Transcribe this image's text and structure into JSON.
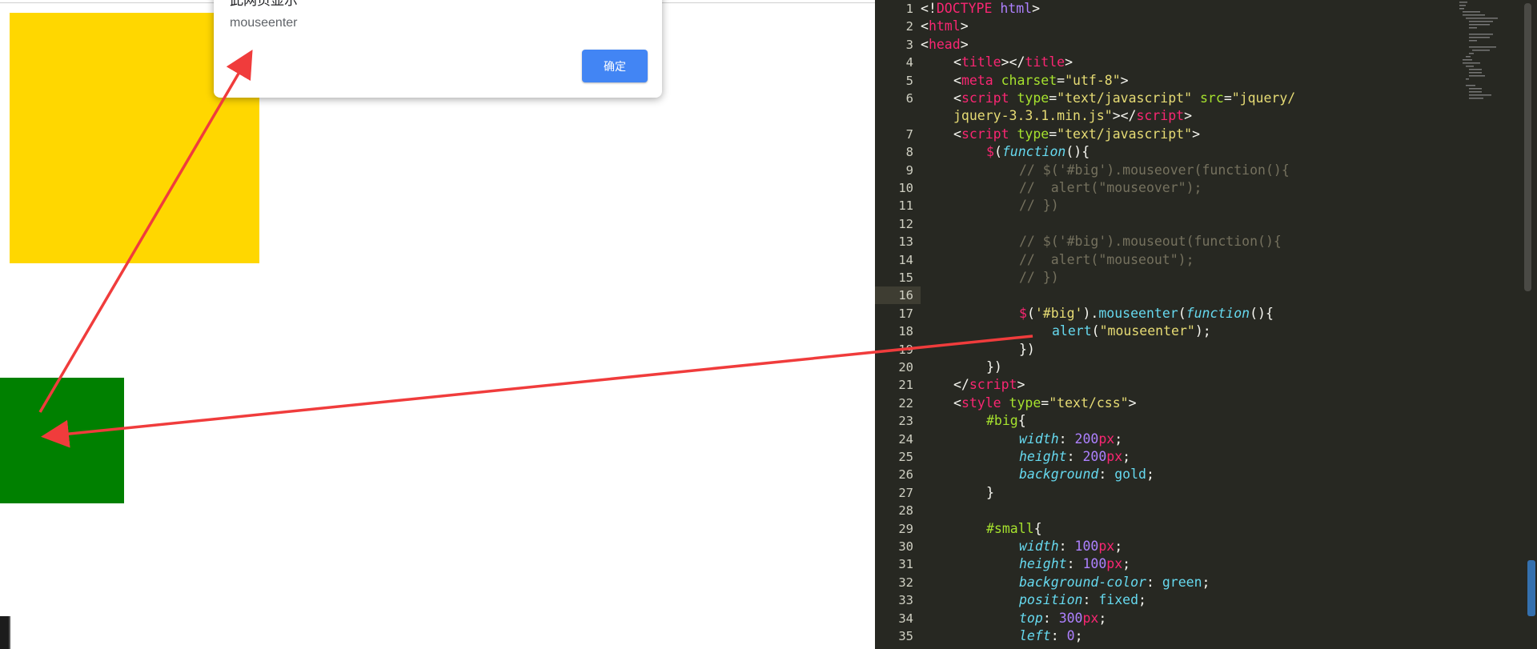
{
  "browser": {
    "dialog": {
      "title": "此网页显示",
      "message": "mouseenter",
      "ok_label": "确定"
    },
    "boxes": {
      "big": {
        "color": "#ffd700"
      },
      "small": {
        "color": "#008000"
      }
    },
    "annotation_color": "#f03c3c"
  },
  "editor": {
    "theme": {
      "background": "#272822"
    },
    "current_line": 16,
    "lines": [
      {
        "n": 1,
        "indent": 0,
        "tokens": [
          [
            "p",
            "<!"
          ],
          [
            "t",
            "DOCTYPE"
          ],
          [
            "p",
            " "
          ],
          [
            "n",
            "html"
          ],
          [
            "p",
            ">"
          ]
        ]
      },
      {
        "n": 2,
        "indent": 0,
        "tokens": [
          [
            "p",
            "<"
          ],
          [
            "t",
            "html"
          ],
          [
            "p",
            ">"
          ]
        ]
      },
      {
        "n": 3,
        "indent": 0,
        "tokens": [
          [
            "p",
            "<"
          ],
          [
            "t",
            "head"
          ],
          [
            "p",
            ">"
          ]
        ]
      },
      {
        "n": 4,
        "indent": 1,
        "tokens": [
          [
            "p",
            "<"
          ],
          [
            "t",
            "title"
          ],
          [
            "p",
            "></"
          ],
          [
            "t",
            "title"
          ],
          [
            "p",
            ">"
          ]
        ]
      },
      {
        "n": 5,
        "indent": 1,
        "tokens": [
          [
            "p",
            "<"
          ],
          [
            "t",
            "meta"
          ],
          [
            "p",
            " "
          ],
          [
            "a",
            "charset"
          ],
          [
            "p",
            "="
          ],
          [
            "s",
            "\"utf-8\""
          ],
          [
            "p",
            ">"
          ]
        ]
      },
      {
        "n": 6,
        "indent": 1,
        "tokens": [
          [
            "p",
            "<"
          ],
          [
            "t",
            "script"
          ],
          [
            "p",
            " "
          ],
          [
            "a",
            "type"
          ],
          [
            "p",
            "="
          ],
          [
            "s",
            "\"text/javascript\""
          ],
          [
            "p",
            " "
          ],
          [
            "a",
            "src"
          ],
          [
            "p",
            "="
          ],
          [
            "s",
            "\"jquery/"
          ]
        ]
      },
      {
        "n": "",
        "indent": 1,
        "tokens": [
          [
            "s",
            "jquery-3.3.1.min.js\""
          ],
          [
            "p",
            "></"
          ],
          [
            "t",
            "script"
          ],
          [
            "p",
            ">"
          ]
        ]
      },
      {
        "n": 7,
        "indent": 1,
        "tokens": [
          [
            "p",
            "<"
          ],
          [
            "t",
            "script"
          ],
          [
            "p",
            " "
          ],
          [
            "a",
            "type"
          ],
          [
            "p",
            "="
          ],
          [
            "s",
            "\"text/javascript\""
          ],
          [
            "p",
            ">"
          ]
        ]
      },
      {
        "n": 8,
        "indent": 2,
        "tokens": [
          [
            "t",
            "$"
          ],
          [
            "p",
            "("
          ],
          [
            "k",
            "function"
          ],
          [
            "p",
            "(){"
          ]
        ]
      },
      {
        "n": 9,
        "indent": 3,
        "tokens": [
          [
            "c",
            "// $('#big').mouseover(function(){"
          ]
        ]
      },
      {
        "n": 10,
        "indent": 3,
        "tokens": [
          [
            "c",
            "//  alert(\"mouseover\");"
          ]
        ]
      },
      {
        "n": 11,
        "indent": 3,
        "tokens": [
          [
            "c",
            "// })"
          ]
        ]
      },
      {
        "n": 12,
        "indent": 0,
        "tokens": []
      },
      {
        "n": 13,
        "indent": 3,
        "tokens": [
          [
            "c",
            "// $('#big').mouseout(function(){"
          ]
        ]
      },
      {
        "n": 14,
        "indent": 3,
        "tokens": [
          [
            "c",
            "//  alert(\"mouseout\");"
          ]
        ]
      },
      {
        "n": 15,
        "indent": 3,
        "tokens": [
          [
            "c",
            "// })"
          ]
        ]
      },
      {
        "n": 16,
        "indent": 0,
        "tokens": []
      },
      {
        "n": 17,
        "indent": 3,
        "tokens": [
          [
            "t",
            "$"
          ],
          [
            "p",
            "("
          ],
          [
            "s",
            "'#big'"
          ],
          [
            "p",
            ")."
          ],
          [
            "f",
            "mouseenter"
          ],
          [
            "p",
            "("
          ],
          [
            "k",
            "function"
          ],
          [
            "p",
            "(){"
          ]
        ]
      },
      {
        "n": 18,
        "indent": 4,
        "tokens": [
          [
            "f",
            "alert"
          ],
          [
            "p",
            "("
          ],
          [
            "s",
            "\"mouseenter\""
          ],
          [
            "p",
            ");"
          ]
        ]
      },
      {
        "n": 19,
        "indent": 3,
        "tokens": [
          [
            "p",
            "})"
          ]
        ]
      },
      {
        "n": 20,
        "indent": 2,
        "tokens": [
          [
            "p",
            "})"
          ]
        ]
      },
      {
        "n": 21,
        "indent": 1,
        "tokens": [
          [
            "p",
            "</"
          ],
          [
            "t",
            "script"
          ],
          [
            "p",
            ">"
          ]
        ]
      },
      {
        "n": 22,
        "indent": 1,
        "tokens": [
          [
            "p",
            "<"
          ],
          [
            "t",
            "style"
          ],
          [
            "p",
            " "
          ],
          [
            "a",
            "type"
          ],
          [
            "p",
            "="
          ],
          [
            "s",
            "\"text/css\""
          ],
          [
            "p",
            ">"
          ]
        ]
      },
      {
        "n": 23,
        "indent": 2,
        "tokens": [
          [
            "a",
            "#big"
          ],
          [
            "p",
            "{"
          ]
        ]
      },
      {
        "n": 24,
        "indent": 3,
        "tokens": [
          [
            "prop",
            "width"
          ],
          [
            "p",
            ": "
          ],
          [
            "n",
            "200"
          ],
          [
            "t",
            "px"
          ],
          [
            "p",
            ";"
          ]
        ]
      },
      {
        "n": 25,
        "indent": 3,
        "tokens": [
          [
            "prop",
            "height"
          ],
          [
            "p",
            ": "
          ],
          [
            "n",
            "200"
          ],
          [
            "t",
            "px"
          ],
          [
            "p",
            ";"
          ]
        ]
      },
      {
        "n": 26,
        "indent": 3,
        "tokens": [
          [
            "prop",
            "background"
          ],
          [
            "p",
            ": "
          ],
          [
            "v",
            "gold"
          ],
          [
            "p",
            ";"
          ]
        ]
      },
      {
        "n": 27,
        "indent": 2,
        "tokens": [
          [
            "p",
            "}"
          ]
        ]
      },
      {
        "n": 28,
        "indent": 0,
        "tokens": []
      },
      {
        "n": 29,
        "indent": 2,
        "tokens": [
          [
            "a",
            "#small"
          ],
          [
            "p",
            "{"
          ]
        ]
      },
      {
        "n": 30,
        "indent": 3,
        "tokens": [
          [
            "prop",
            "width"
          ],
          [
            "p",
            ": "
          ],
          [
            "n",
            "100"
          ],
          [
            "t",
            "px"
          ],
          [
            "p",
            ";"
          ]
        ]
      },
      {
        "n": 31,
        "indent": 3,
        "tokens": [
          [
            "prop",
            "height"
          ],
          [
            "p",
            ": "
          ],
          [
            "n",
            "100"
          ],
          [
            "t",
            "px"
          ],
          [
            "p",
            ";"
          ]
        ]
      },
      {
        "n": 32,
        "indent": 3,
        "tokens": [
          [
            "prop",
            "background-color"
          ],
          [
            "p",
            ": "
          ],
          [
            "v",
            "green"
          ],
          [
            "p",
            ";"
          ]
        ]
      },
      {
        "n": 33,
        "indent": 3,
        "tokens": [
          [
            "prop",
            "position"
          ],
          [
            "p",
            ": "
          ],
          [
            "v",
            "fixed"
          ],
          [
            "p",
            ";"
          ]
        ]
      },
      {
        "n": 34,
        "indent": 3,
        "tokens": [
          [
            "prop",
            "top"
          ],
          [
            "p",
            ": "
          ],
          [
            "n",
            "300"
          ],
          [
            "t",
            "px"
          ],
          [
            "p",
            ";"
          ]
        ]
      },
      {
        "n": 35,
        "indent": 3,
        "tokens": [
          [
            "prop",
            "left"
          ],
          [
            "p",
            ": "
          ],
          [
            "n",
            "0"
          ],
          [
            "p",
            ";"
          ]
        ]
      }
    ]
  }
}
